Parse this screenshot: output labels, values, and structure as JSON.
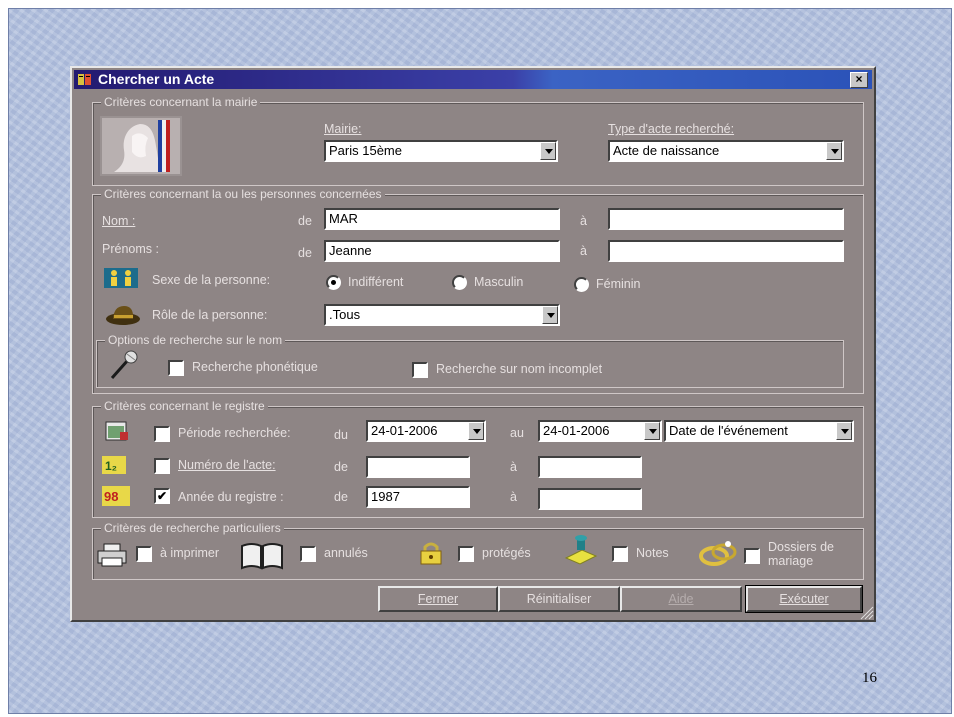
{
  "dialog": {
    "title": "Chercher un Acte",
    "close_label": "×"
  },
  "mairie_group": {
    "legend": "Critères concernant la mairie",
    "mairie_label": "Mairie:",
    "mairie_value": "Paris 15ème",
    "type_label": "Type d'acte recherché:",
    "type_value": "Acte de naissance"
  },
  "personnes_group": {
    "legend": "Critères concernant la ou les personnes concernées",
    "nom_label": "Nom :",
    "nom_de": "de",
    "nom_from": "MAR",
    "nom_a": "à",
    "nom_to": "",
    "prenoms_label": "Prénoms :",
    "prenoms_de": "de",
    "prenoms_from": "Jeanne",
    "prenoms_a": "à",
    "prenoms_to": "",
    "sexe_label": "Sexe de la personne:",
    "sexe_options": [
      "Indifférent",
      "Masculin",
      "Féminin"
    ],
    "sexe_selected": "Indifférent",
    "role_label": "Rôle de la personne:",
    "role_value": ".Tous",
    "options_legend": "Options de recherche sur le nom",
    "phonetique_label": "Recherche phonétique",
    "incomplet_label": "Recherche sur nom incomplet"
  },
  "registre_group": {
    "legend": "Critères concernant le registre",
    "periode_label": "Période recherchée:",
    "periode_du": "du",
    "periode_from": "24-01-2006",
    "periode_au": "au",
    "periode_to": "24-01-2006",
    "date_type": "Date de l'événement",
    "numero_label": "Numéro de l'acte:",
    "numero_de": "de",
    "numero_from": "",
    "numero_a": "à",
    "numero_to": "",
    "annee_label": "Année du registre :",
    "annee_de": "de",
    "annee_from": "1987",
    "annee_a": "à",
    "annee_to": "",
    "annee_checked": "✔",
    "icon_numero_text": "1₂",
    "icon_annee_text": "98"
  },
  "particuliers_group": {
    "legend": "Critères de recherche particuliers",
    "imprimer": "à imprimer",
    "annules": "annulés",
    "proteges": "protégés",
    "notes": "Notes",
    "dossiers": "Dossiers de mariage"
  },
  "buttons": {
    "fermer": "Fermer",
    "reinitialiser": "Réinitialiser",
    "aide": "Aide",
    "executer": "Exécuter"
  },
  "slide": {
    "page_number": "16"
  }
}
